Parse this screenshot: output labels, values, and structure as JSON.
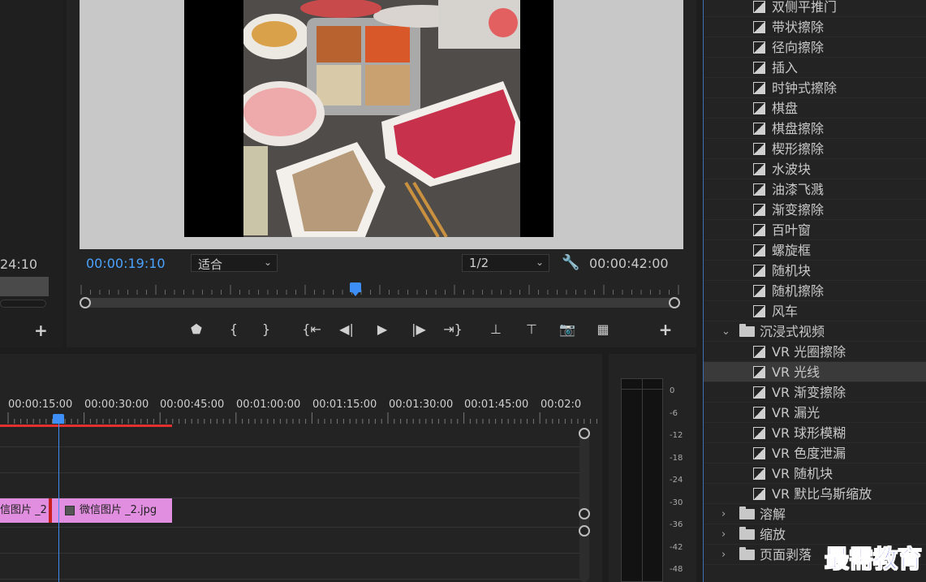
{
  "source_monitor": {
    "timecode": "24:10",
    "add_label": "+"
  },
  "program_monitor": {
    "current_time": "00:00:19:10",
    "fit_option": "适合",
    "resolution": "1/2",
    "duration": "00:00:42:00",
    "add_label": "+",
    "playhead_fraction": 0.46
  },
  "controls": [
    {
      "name": "marker-icon",
      "glyph": "⬟"
    },
    {
      "name": "mark-in-icon",
      "glyph": "{"
    },
    {
      "name": "mark-out-icon",
      "glyph": "}"
    },
    {
      "name": "go-to-in-icon",
      "glyph": "{⇤"
    },
    {
      "name": "step-back-icon",
      "glyph": "◀|"
    },
    {
      "name": "play-icon",
      "glyph": "▶"
    },
    {
      "name": "step-forward-icon",
      "glyph": "|▶"
    },
    {
      "name": "go-to-out-icon",
      "glyph": "⇥}"
    },
    {
      "name": "lift-icon",
      "glyph": "⊥"
    },
    {
      "name": "extract-icon",
      "glyph": "⊤"
    },
    {
      "name": "camera-icon",
      "glyph": "📷"
    },
    {
      "name": "comparison-icon",
      "glyph": "▦"
    }
  ],
  "timeline": {
    "timecodes": [
      "00:00:15:00",
      "00:00:30:00",
      "00:00:45:00",
      "00:01:00:00",
      "00:01:15:00",
      "00:01:30:00",
      "00:01:45:00",
      "00:02:0"
    ],
    "clip_a": "信图片 _2",
    "clip_b": "微信图片 _2.jpg"
  },
  "audio_meter": {
    "scale": [
      "0",
      "-6",
      "-12",
      "-18",
      "-24",
      "-30",
      "-36",
      "-42",
      "-48"
    ]
  },
  "effects": {
    "items": [
      {
        "type": "effect",
        "label": "双侧平推门"
      },
      {
        "type": "effect",
        "label": "带状擦除"
      },
      {
        "type": "effect",
        "label": "径向擦除"
      },
      {
        "type": "effect",
        "label": "插入"
      },
      {
        "type": "effect",
        "label": "时钟式擦除"
      },
      {
        "type": "effect",
        "label": "棋盘"
      },
      {
        "type": "effect",
        "label": "棋盘擦除"
      },
      {
        "type": "effect",
        "label": "楔形擦除"
      },
      {
        "type": "effect",
        "label": "水波块"
      },
      {
        "type": "effect",
        "label": "油漆飞溅"
      },
      {
        "type": "effect",
        "label": "渐变擦除"
      },
      {
        "type": "effect",
        "label": "百叶窗"
      },
      {
        "type": "effect",
        "label": "螺旋框"
      },
      {
        "type": "effect",
        "label": "随机块"
      },
      {
        "type": "effect",
        "label": "随机擦除"
      },
      {
        "type": "effect",
        "label": "风车"
      },
      {
        "type": "folder",
        "label": "沉浸式视频",
        "expanded": true
      },
      {
        "type": "effect",
        "label": "VR 光圈擦除"
      },
      {
        "type": "effect",
        "label": "VR 光线",
        "selected": true
      },
      {
        "type": "effect",
        "label": "VR 渐变擦除"
      },
      {
        "type": "effect",
        "label": "VR 漏光"
      },
      {
        "type": "effect",
        "label": "VR 球形模糊"
      },
      {
        "type": "effect",
        "label": "VR 色度泄漏"
      },
      {
        "type": "effect",
        "label": "VR 随机块"
      },
      {
        "type": "effect",
        "label": "VR 默比乌斯缩放"
      },
      {
        "type": "folder",
        "label": "溶解",
        "expanded": false
      },
      {
        "type": "folder",
        "label": "缩放",
        "expanded": false
      },
      {
        "type": "folder",
        "label": "页面剥落",
        "expanded": false
      }
    ]
  },
  "watermark": "最需教育"
}
